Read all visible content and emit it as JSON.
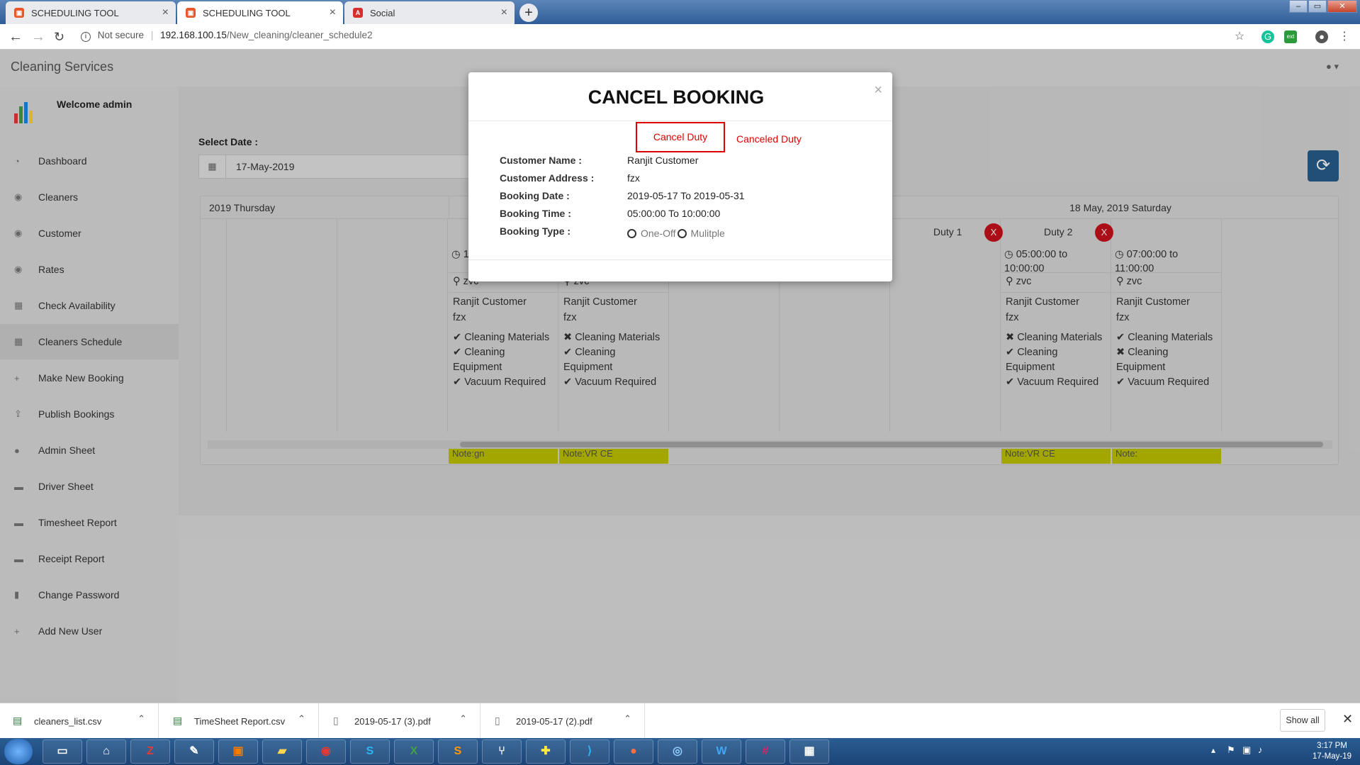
{
  "browser": {
    "tabs": [
      {
        "title": "SCHEDULING TOOL",
        "active": false
      },
      {
        "title": "SCHEDULING TOOL",
        "active": true
      },
      {
        "title": "Social",
        "active": false
      }
    ],
    "security_label": "Not secure",
    "url_host": "192.168.100.15",
    "url_path": "/New_cleaning/cleaner_schedule2"
  },
  "app": {
    "brand": "Cleaning Services",
    "welcome": "Welcome admin",
    "sidebar": [
      {
        "label": "Dashboard",
        "icon": "dashboard-icon"
      },
      {
        "label": "Cleaners",
        "icon": "users-icon"
      },
      {
        "label": "Customer",
        "icon": "users-icon"
      },
      {
        "label": "Rates",
        "icon": "users-icon"
      },
      {
        "label": "Check Availability",
        "icon": "calendar-icon"
      },
      {
        "label": "Cleaners Schedule",
        "icon": "calendar-icon",
        "active": true
      },
      {
        "label": "Make New Booking",
        "icon": "plus-icon"
      },
      {
        "label": "Publish Bookings",
        "icon": "upload-icon"
      },
      {
        "label": "Admin Sheet",
        "icon": "user-icon"
      },
      {
        "label": "Driver Sheet",
        "icon": "car-icon"
      },
      {
        "label": "Timesheet Report",
        "icon": "car-icon"
      },
      {
        "label": "Receipt Report",
        "icon": "car-icon"
      },
      {
        "label": "Change Password",
        "icon": "lock-icon"
      },
      {
        "label": "Add New User",
        "icon": "plus-icon"
      }
    ],
    "select_date_label": "Select Date :",
    "selected_date": "17-May-2019"
  },
  "schedule": {
    "day_left": "2019 Thursday",
    "day_right": "18 May, 2019 Saturday",
    "cards": [
      {
        "time": "11:",
        "loc": "zvc",
        "customer": "Ranjit Customer",
        "addr": "fzx",
        "flags": [
          [
            "check",
            "Cleaning Materials"
          ],
          [
            "check",
            "Cleaning Equipment"
          ],
          [
            "check",
            "Vacuum Required"
          ]
        ],
        "note": "Note:gn"
      },
      {
        "time": "",
        "loc": "zvc",
        "customer": "Ranjit Customer",
        "addr": "fzx",
        "flags": [
          [
            "cross",
            "Cleaning Materials"
          ],
          [
            "check",
            "Cleaning Equipment"
          ],
          [
            "check",
            "Vacuum Required"
          ]
        ],
        "note": "Note:VR CE"
      },
      {
        "duty": "Duty 1",
        "x": "X",
        "time": "05:00:00 to 10:00:00",
        "loc": "zvc",
        "customer": "Ranjit Customer",
        "addr": "fzx",
        "flags": [
          [
            "cross",
            "Cleaning Materials"
          ],
          [
            "check",
            "Cleaning Equipment"
          ],
          [
            "check",
            "Vacuum Required"
          ]
        ],
        "note": "Note:VR CE"
      },
      {
        "duty": "Duty 2",
        "x": "X",
        "time": "07:00:00 to 11:00:00",
        "loc": "zvc",
        "customer": "Ranjit Customer",
        "addr": "fzx",
        "flags": [
          [
            "check",
            "Cleaning Materials"
          ],
          [
            "cross",
            "Cleaning Equipment"
          ],
          [
            "check",
            "Vacuum Required"
          ]
        ],
        "note": "Note:"
      }
    ]
  },
  "modal": {
    "title": "CANCEL BOOKING",
    "cancel_button": "Cancel Duty",
    "canceled_link": "Canceled Duty",
    "rows": [
      {
        "label": "Customer Name :",
        "value": "Ranjit Customer"
      },
      {
        "label": "Customer Address :",
        "value": "fzx"
      },
      {
        "label": "Booking Date :",
        "value": "2019-05-17 To 2019-05-31"
      },
      {
        "label": "Booking Time :",
        "value": "05:00:00 To 10:00:00"
      },
      {
        "label": "Booking Type :",
        "value": ""
      }
    ],
    "booking_type_options": [
      "One-Off",
      "Mulitple"
    ]
  },
  "downloads": {
    "items": [
      "cleaners_list.csv",
      "TimeSheet Report.csv",
      "2019-05-17 (3).pdf",
      "2019-05-17 (2).pdf"
    ],
    "show_all": "Show all"
  },
  "taskbar": {
    "time": "3:17 PM",
    "date": "17-May-19"
  },
  "colors": {
    "accent": "#285d8c",
    "danger": "#c9111b",
    "note_bg": "#c1c400"
  }
}
